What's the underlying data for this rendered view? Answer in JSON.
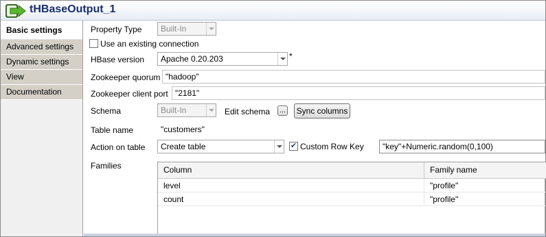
{
  "header": {
    "title": "tHBaseOutput_1",
    "icon": "component-arrow-icon"
  },
  "sidebar": {
    "tabs": [
      {
        "label": "Basic settings",
        "active": true
      },
      {
        "label": "Advanced settings",
        "active": false
      },
      {
        "label": "Dynamic settings",
        "active": false
      },
      {
        "label": "View",
        "active": false
      },
      {
        "label": "Documentation",
        "active": false
      }
    ]
  },
  "form": {
    "property_type": {
      "label": "Property Type",
      "value": "Built-In"
    },
    "use_existing": {
      "label": "Use an existing connection",
      "checked": false
    },
    "hbase_version": {
      "label": "HBase version",
      "value": "Apache 0.20.203",
      "required_mark": "*"
    },
    "zk_quorum": {
      "label": "Zookeeper quorum",
      "value": "\"hadoop\""
    },
    "zk_port": {
      "label": "Zookeeper client port",
      "value": "\"2181\""
    },
    "schema": {
      "label": "Schema",
      "value": "Built-In",
      "edit_label": "Edit schema",
      "edit_button": "...",
      "sync_button": "Sync columns"
    },
    "table_name": {
      "label": "Table name",
      "value": "\"customers\""
    },
    "action": {
      "label": "Action on table",
      "value": "Create table"
    },
    "custom_row_key": {
      "label": "Custom Row Key",
      "checked": true,
      "value": "\"key\"+Numeric.random(0,100)"
    },
    "families": {
      "label": "Families",
      "columns": [
        "Column",
        "Family name"
      ],
      "rows": [
        [
          "level",
          "\"profile\""
        ],
        [
          "count",
          "\"profile\""
        ]
      ]
    }
  }
}
